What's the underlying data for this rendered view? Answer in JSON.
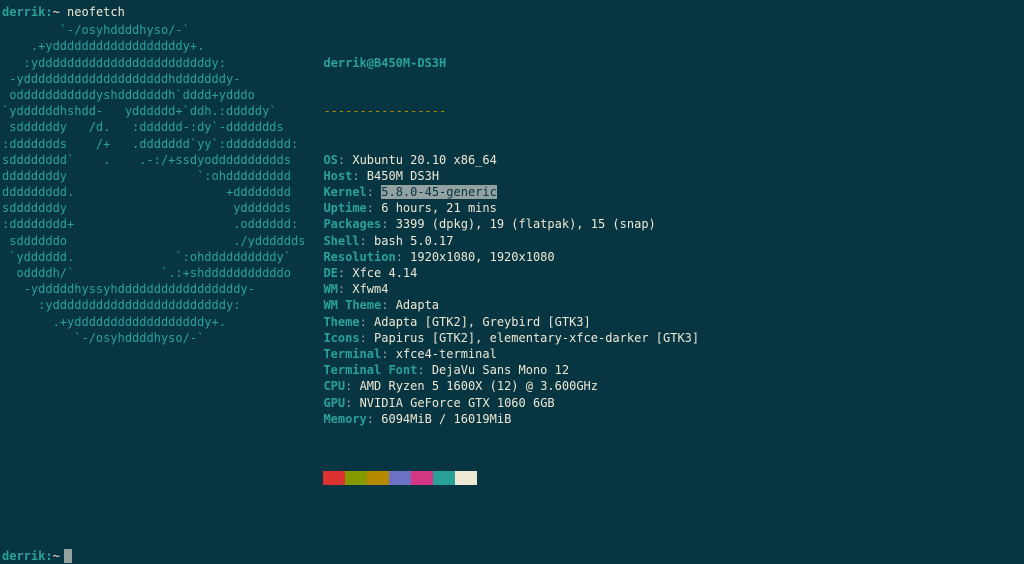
{
  "prompt": {
    "user": "derrik:",
    "tilde": "~",
    "command": "neofetch"
  },
  "ascii_art": "        `-/osyhddddhyso/-`\n    .+yddddddddddddddddddy+.\n   :yddddddddddddddddddddddddy:\n -yddddddddddddddddddddhdddddddy-\n odddddddddddyshdddddddh`dddd+ydddo\n`yddddddhshdd-   ydddddd+`ddh.:dddddy`\n sddddddy   /d.   :dddddd-:dy`-ddddddds\n:ddddddds    /+   .ddddddd`yy`:ddddddddd:\nsdddddddd`    .    .-:/+ssdyodddddddddds\nddddddddy                  `:ohddddddddd\nddddddddd.                     +dddddddd\nsdddddddy                       ydddddds\n:dddddddd+                      .odddddd:\n sddddddo                       ./ydddddds\n `ydddddd.              `:ohddddddddddy`\n  oddddh/`            `.:+shdddddddddddo\n   -ydddddhyssyhdddddddddddddddddy-\n     :yddddddddddddddddddddddddy:\n       .+yddddddddddddddddddy+.\n          `-/osyhddddhyso/-`",
  "sysinfo": {
    "title": "derrik@B450M-DS3H",
    "dashes": "-----------------",
    "rows": [
      {
        "label": "OS",
        "value": "Xubuntu 20.10 x86_64"
      },
      {
        "label": "Host",
        "value": "B450M DS3H"
      },
      {
        "label": "Kernel",
        "value": "5.8.0-45-generic",
        "highlight": true
      },
      {
        "label": "Uptime",
        "value": "6 hours, 21 mins"
      },
      {
        "label": "Packages",
        "value": "3399 (dpkg), 19 (flatpak), 15 (snap)"
      },
      {
        "label": "Shell",
        "value": "bash 5.0.17"
      },
      {
        "label": "Resolution",
        "value": "1920x1080, 1920x1080"
      },
      {
        "label": "DE",
        "value": "Xfce 4.14"
      },
      {
        "label": "WM",
        "value": "Xfwm4"
      },
      {
        "label": "WM Theme",
        "value": "Adapta"
      },
      {
        "label": "Theme",
        "value": "Adapta [GTK2], Greybird [GTK3]"
      },
      {
        "label": "Icons",
        "value": "Papirus [GTK2], elementary-xfce-darker [GTK3]"
      },
      {
        "label": "Terminal",
        "value": "xfce4-terminal"
      },
      {
        "label": "Terminal Font",
        "value": "DejaVu Sans Mono 12"
      },
      {
        "label": "CPU",
        "value": "AMD Ryzen 5 1600X (12) @ 3.600GHz"
      },
      {
        "label": "GPU",
        "value": "NVIDIA GeForce GTX 1060 6GB"
      },
      {
        "label": "Memory",
        "value": "6094MiB / 16019MiB"
      }
    ]
  },
  "colors": {
    "row1": [
      "#dc322f",
      "#859900",
      "#b58900",
      "#6c71c4",
      "#d33682",
      "#2aa198",
      "#eee8d5"
    ]
  },
  "final_prompt": {
    "user": "derrik:",
    "tilde": "~"
  }
}
